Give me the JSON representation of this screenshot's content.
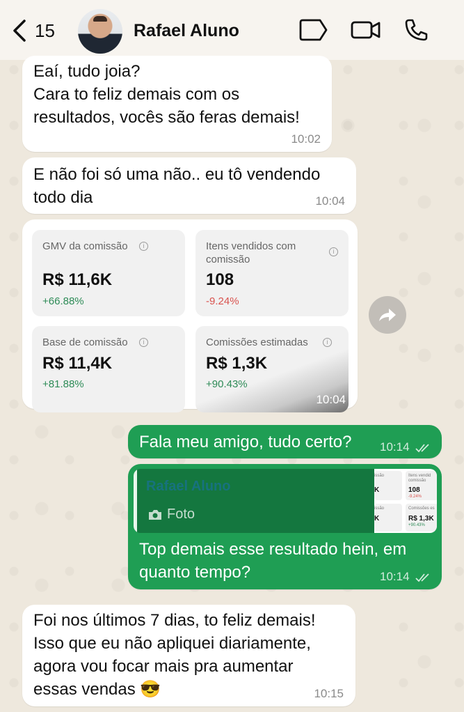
{
  "header": {
    "back_count": "15",
    "contact_name": "Rafael Aluno"
  },
  "messages": [
    {
      "text": "Eaí, tudo joia?\nCara to feliz demais com os\nresultados, vocês são feras demais!",
      "time": "10:02"
    },
    {
      "text": "E não foi só uma não.. eu tô vendendo\ntodo dia",
      "time": "10:04"
    }
  ],
  "stats_card": {
    "time": "10:04",
    "items": [
      {
        "label": "GMV da comissão",
        "value": "R$ 11,6K",
        "change": "+66.88%"
      },
      {
        "label": "Itens vendidos com comissão",
        "value": "108",
        "change": "-9.24%"
      },
      {
        "label": "Base de comissão",
        "value": "R$ 11,4K",
        "change": "+81.88%"
      },
      {
        "label": "Comissões estimadas",
        "value": "R$ 1,3K",
        "change": "+90.43%"
      }
    ]
  },
  "outgoing": [
    {
      "text": "Fala meu amigo, tudo certo?",
      "time": "10:14"
    },
    {
      "quote_author": "Rafael Aluno",
      "quote_type": "Foto",
      "thumb": {
        "item1": "108",
        "item1_label": "Itens vendid comissão",
        "item1_pct": "-9.24%",
        "item2": "R$ 1,3K",
        "item2_label": "Comissões es",
        "item2_pct": "+90.43%",
        "left1": "K",
        "left1_label": "issão",
        "left2": "K",
        "left2_label": "issão"
      },
      "text": "Top demais esse resultado hein, em\nquanto tempo?",
      "time": "10:14"
    }
  ],
  "last_message": {
    "text": "Foi nos últimos 7 dias, to feliz demais!\nIsso que eu não apliquei diariamente,\nagora vou focar mais pra aumentar\nessas vendas 😎",
    "time": "10:15"
  }
}
